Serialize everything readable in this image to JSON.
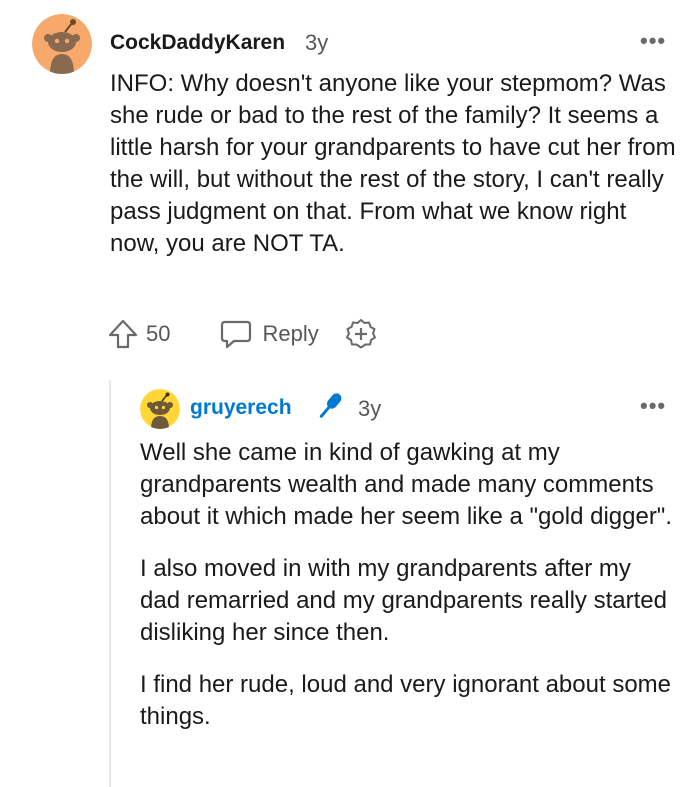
{
  "comment": {
    "username": "CockDaddyKaren",
    "age": "3y",
    "more_icon": "ellipsis-icon",
    "text": "INFO: Why doesn't anyone like your stepmom? Was she rude or bad to the rest of the family? It seems a little harsh for your grandparents to have cut her from the will, but without the rest of the story, I can't really pass judgment on that. From what we know right now, you are NOT TA.",
    "actions": {
      "upvote_icon": "upvote-arrow-icon",
      "vote_count": "50",
      "reply_icon": "speech-bubble-icon",
      "reply_label": "Reply",
      "award_icon": "add-award-icon"
    }
  },
  "reply": {
    "username": "gruyerech",
    "badge_icon": "microphone-icon",
    "age": "3y",
    "more_icon": "ellipsis-icon",
    "paragraphs": [
      "Well she came in kind of gawking at my grandparents wealth and made many comments about it which made her seem like a \"gold digger\".",
      "I also moved in with my grandparents after my dad remarried and my grandparents really started disliking her since then.",
      "I find her rude, loud and very ignorant about some things."
    ]
  },
  "colors": {
    "username_accent": "#0079d3",
    "avatar_orange": "#f6a96b",
    "avatar_yellow": "#ffd635",
    "text": "#1a1a1b",
    "muted": "#575757"
  }
}
